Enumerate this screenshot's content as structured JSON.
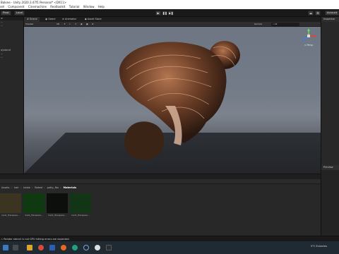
{
  "window": {
    "title": "Balone - Unity 2020.3.47f1 Personal* <DX11>"
  },
  "menu": [
    "set",
    "Component",
    "Cinemachine",
    "Realtoolkit",
    "Tutorial",
    "Window",
    "Help"
  ],
  "toolbar": {
    "pivot_label": "Pivot",
    "local_label": "Local",
    "play_glyph": "▶",
    "pause_glyph": "❚❚",
    "step_glyph": "▶❚",
    "account_label": "Account"
  },
  "center_tabs": [
    {
      "label": "Scene",
      "glyph": "#"
    },
    {
      "label": "Game",
      "glyph": "◉"
    },
    {
      "label": "Animator",
      "glyph": "≡"
    },
    {
      "label": "Asset Store",
      "glyph": "◆"
    }
  ],
  "scene_toolbar": {
    "shading_mode": "Shaded",
    "mode_2d": "2D",
    "gizmos_label": "Gizmos",
    "search_placeholder": "All"
  },
  "gizmo": {
    "label": "< Persp"
  },
  "hierarchy": {
    "items": [
      "...",
      "...",
      "oystand",
      "...",
      "..."
    ]
  },
  "right_panel": {
    "inspector_label": "Inspector",
    "preview_label": "Preview"
  },
  "project": {
    "breadcrumb": [
      "Assets",
      "hair",
      "balok",
      "Baked",
      "potty_fbx",
      "Materials"
    ],
    "assets": [
      {
        "label": "hair1_Transpare...",
        "color": "#3a3420"
      },
      {
        "label": "hair1_Transpare...",
        "color": "#0f3a10"
      },
      {
        "label": "hair1_Transpare...",
        "color": "#0d0f0d"
      },
      {
        "label": "hair1_Transpare...",
        "color": "#123516"
      }
    ]
  },
  "status": {
    "message": "Render stencil is not GPU hitting errors are expected."
  },
  "taskbar": {
    "weather": "5°C  Eclarcies",
    "icons": [
      "start",
      "search",
      "folder",
      "chrome",
      "word",
      "firefox",
      "edge",
      "steam",
      "unity",
      "vscode"
    ]
  },
  "colors": {
    "accent": "#3a79bb",
    "hair_brown": "#7a4a2e",
    "hair_highlight": "#d4a27a",
    "hair_dark": "#2a1810"
  }
}
